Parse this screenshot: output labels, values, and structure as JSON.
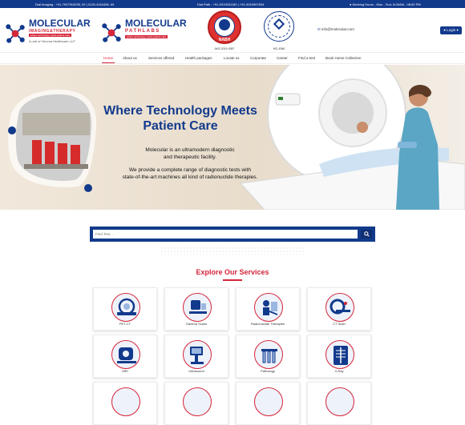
{
  "topbar": {
    "dial_imaging": "Dial Imaging : +91-7947910035, 92 | 0120-4154456, 69",
    "dial_path": "Dial Path : +91-9319031150 | +91-9319097634",
    "working_hours": "Working Hours - Mon - Sun: 8:00AM - 08:00 PM"
  },
  "logos": {
    "imaging_title": "MOLECULAR",
    "imaging_subtitle": "IMAGING&THERAPY",
    "imaging_tagline": "where technology meets patient care",
    "imaging_unit": "A unit of Vinoma Healthcare LLP",
    "pathlabs_title": "MOLECULAR",
    "pathlabs_subtitle": "PATHLABS",
    "pathlabs_tagline": "where technology meets patient care",
    "nabh_text": "NABH",
    "nabh_code": "AKS-2019-0087",
    "seal2_code": "MC-4366"
  },
  "header": {
    "email": "info@molecular.com",
    "login": "Login"
  },
  "nav": {
    "items": [
      "Home",
      "About us",
      "Services offered",
      "Health packages",
      "Locate us",
      "Corporate",
      "Career",
      "Find a test",
      "Book Home Collection"
    ]
  },
  "hero": {
    "headline_line1": "Where Technology Meets",
    "headline_line2": "Patient Care",
    "desc_line1": "Molecular is an ultramodern diagnostic",
    "desc_line2": "and therapeutic facility.",
    "desc_line3": "We provide a complete range of diagnostic tests with",
    "desc_line4": "state-of-the-art machines all kind of radionuclide therapies."
  },
  "search": {
    "placeholder": "Find Test..."
  },
  "services": {
    "heading": "Explore Our Services",
    "items": [
      "PET-CT",
      "Gamma Scans",
      "Radionuclide Therapies",
      "CT Scan",
      "MRI",
      "Ultrasound",
      "Pathology",
      "X-Ray"
    ]
  },
  "colors": {
    "brand_blue": "#123a8c",
    "accent_red": "#d5253a"
  }
}
